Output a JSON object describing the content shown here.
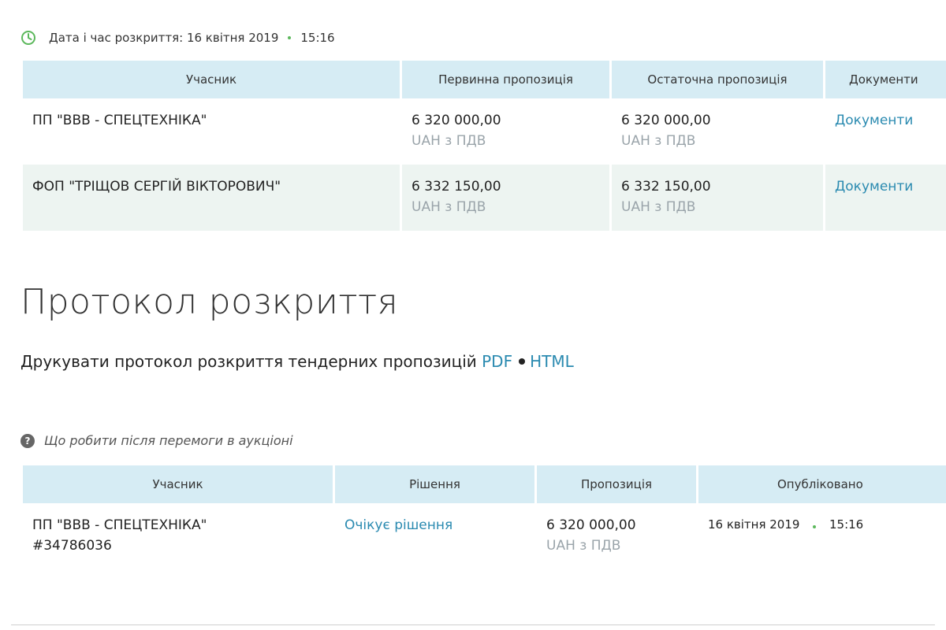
{
  "opening": {
    "label": "Дата і час розкриття: 16 квітня 2019",
    "time": "15:16",
    "accent": "#5cb85c"
  },
  "bids_table": {
    "headers": [
      "Учасник",
      "Первинна пропозиція",
      "Остаточна пропозиція",
      "Документи"
    ],
    "rows": [
      {
        "participant": "ПП \"ВВВ - СПЕЦТЕХНІКА\"",
        "initial": "6 320 000,00",
        "initial_sub": "UAH з ПДВ",
        "final": "6 320 000,00",
        "final_sub": "UAH з ПДВ",
        "docs": "Документи"
      },
      {
        "participant": "ФОП \"ТРІЩОВ СЕРГІЙ ВІКТОРОВИЧ\"",
        "initial": "6 332 150,00",
        "initial_sub": "UAH з ПДВ",
        "final": "6 332 150,00",
        "final_sub": "UAH з ПДВ",
        "docs": "Документи"
      }
    ]
  },
  "protocol": {
    "title": "Протокол розкриття",
    "print_text": "Друкувати протокол розкриття тендерних пропозицій",
    "pdf": "PDF",
    "html": "HTML"
  },
  "help": {
    "text": "Що робити після перемоги в аукціоні"
  },
  "award_table": {
    "headers": [
      "Учасник",
      "Рішення",
      "Пропозиція",
      "Опубліковано"
    ],
    "rows": [
      {
        "participant": "ПП \"ВВВ - СПЕЦТЕХНІКА\"",
        "participant_id": "#34786036",
        "decision": "Очікує рішення",
        "amount": "6 320 000,00",
        "amount_sub": "UAH з ПДВ",
        "published_date": "16 квітня 2019",
        "published_time": "15:16"
      }
    ]
  },
  "colors": {
    "header_bg": "#d6ecf4",
    "row_alt_bg": "#edf4f1",
    "link": "#2a8ab0",
    "dot_green": "#5cb85c"
  }
}
